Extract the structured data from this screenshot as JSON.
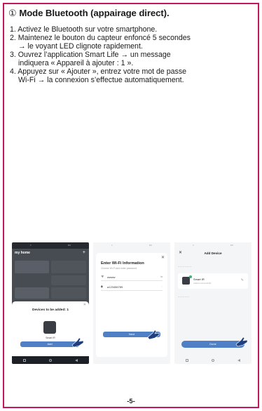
{
  "section": {
    "number": "①",
    "title": "Mode Bluetooth (appairage direct)."
  },
  "steps": [
    {
      "lines": [
        "1. Activez le Bluetooth sur votre smartphone."
      ]
    },
    {
      "lines": [
        "2. Maintenez le bouton du capteur enfoncé 5 secondes",
        "→ le voyant LED clignote rapidement."
      ]
    },
    {
      "lines": [
        "3. Ouvrez l’application Smart Life → un message",
        "indiquera « Appareil à ajouter : 1 »."
      ]
    },
    {
      "lines": [
        "4. Appuyez sur « Ajouter », entrez votre mot de passe",
        "Wi-Fi → la connexion s’effectue automatiquement."
      ]
    }
  ],
  "screenshot1": {
    "home_title": "my home",
    "devices_to_add": "Devices to be added: 1",
    "device_name": "Smart IR",
    "add_button": "Add"
  },
  "screenshot2": {
    "heading": "Enter Wi-Fi Information",
    "subheading": "Choose Wi-Fi and enter password",
    "ssid": "wwww",
    "password": "a123456789",
    "next_button": "Next"
  },
  "screenshot3": {
    "heading": "Add Device",
    "device_name": "Smart IR",
    "device_status": "Added successfully",
    "done_button": "Done"
  },
  "page_number": "-5-",
  "colors": {
    "border": "#c2185b",
    "button": "#4f7fc5"
  }
}
